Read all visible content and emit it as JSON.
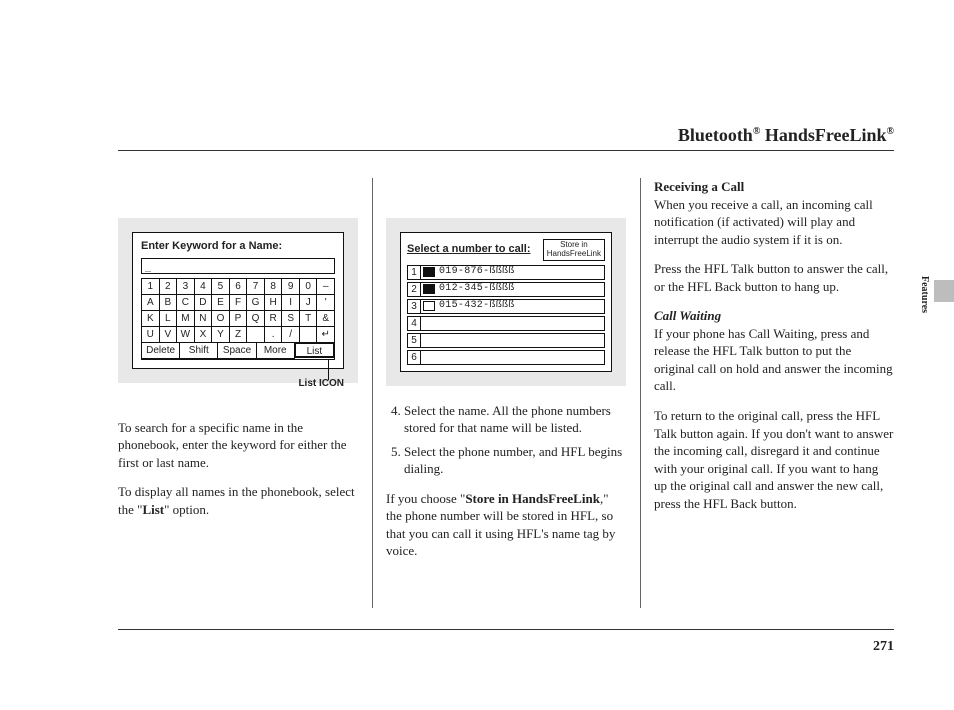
{
  "title": {
    "main": "Bluetooth",
    "reg1": "®",
    "sub": " HandsFreeLink",
    "reg2": "®"
  },
  "side_section": "Features",
  "page_number": "271",
  "col1": {
    "keyboard": {
      "heading": "Enter Keyword for a Name:",
      "input_value": "_",
      "rows": [
        [
          "1",
          "2",
          "3",
          "4",
          "5",
          "6",
          "7",
          "8",
          "9",
          "0",
          "–"
        ],
        [
          "A",
          "B",
          "C",
          "D",
          "E",
          "F",
          "G",
          "H",
          "I",
          "J",
          "'"
        ],
        [
          "K",
          "L",
          "M",
          "N",
          "O",
          "P",
          "Q",
          "R",
          "S",
          "T",
          "&"
        ],
        [
          "U",
          "V",
          "W",
          "X",
          "Y",
          "Z",
          "",
          ".",
          "/",
          "",
          "↵"
        ]
      ],
      "bottom": [
        "Delete",
        "Shift",
        "Space",
        "More",
        "List"
      ],
      "list_label": "List ICON"
    },
    "p1_a": "To search for a specific name in the phonebook, enter the keyword for either the first or last name.",
    "p2_pre": "To display all names in the phonebook, select the \"",
    "p2_bold": "List",
    "p2_post": "\" option."
  },
  "col2": {
    "panel": {
      "heading": "Select a number to call:",
      "button_line1": "Store in",
      "button_line2": "HandsFreeLink",
      "rows": [
        {
          "idx": "1",
          "icon": "mobile",
          "num": "019-876-ßßßß"
        },
        {
          "idx": "2",
          "icon": "mobile",
          "num": "012-345-ßßßß"
        },
        {
          "idx": "3",
          "icon": "home",
          "num": "015-432-ßßßß"
        },
        {
          "idx": "4",
          "icon": "",
          "num": ""
        },
        {
          "idx": "5",
          "icon": "",
          "num": ""
        },
        {
          "idx": "6",
          "icon": "",
          "num": ""
        }
      ]
    },
    "step4": "Select the name. All the phone numbers stored for that name will be listed.",
    "step5": "Select the phone number, and HFL begins dialing.",
    "p_pre": "If you choose \"",
    "p_bold": "Store in HandsFreeLink",
    "p_post": ",\" the phone number will be stored in HFL, so that you can call it using HFL's name tag by voice."
  },
  "col3": {
    "h1": "Receiving a Call",
    "p1": "When you receive a call, an incoming call notification (if activated) will play and interrupt the audio system if it is on.",
    "p2": "Press the HFL Talk button to answer the call, or the HFL Back button to hang up.",
    "h2": "Call Waiting",
    "p3": "If your phone has Call Waiting, press and release the HFL Talk button to put the original call on hold and answer the incoming call.",
    "p4": "To return to the original call, press the HFL Talk button again. If you don't want to answer the incoming call, disregard it and continue with your original call. If you want to hang up the original call and answer the new call, press the HFL Back button."
  }
}
